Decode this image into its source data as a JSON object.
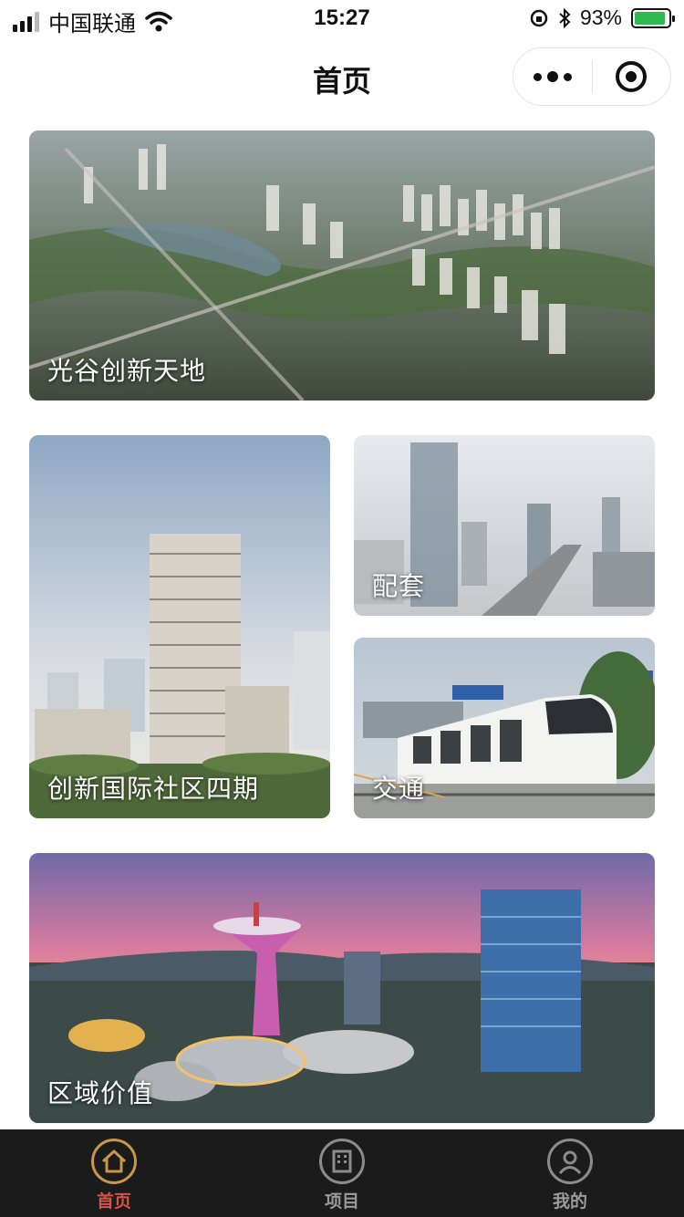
{
  "status_bar": {
    "carrier": "中国联通",
    "time": "15:27",
    "battery_percent": "93%",
    "battery_level": 0.93
  },
  "nav": {
    "title": "首页"
  },
  "cards": {
    "c1": {
      "label": "光谷创新天地"
    },
    "c2": {
      "label": "创新国际社区四期"
    },
    "c3": {
      "label": "配套"
    },
    "c4": {
      "label": "交通"
    },
    "c5": {
      "label": "区域价值"
    }
  },
  "tabs": [
    {
      "label": "首页",
      "icon": "home-icon",
      "active": true
    },
    {
      "label": "项目",
      "icon": "building-icon",
      "active": false
    },
    {
      "label": "我的",
      "icon": "user-icon",
      "active": false
    }
  ],
  "colors": {
    "tab_bar_bg": "#1b1b1b",
    "active_tab": "#d4534a",
    "active_icon_ring": "#c9974a",
    "inactive_tab": "#9a9a9a"
  }
}
